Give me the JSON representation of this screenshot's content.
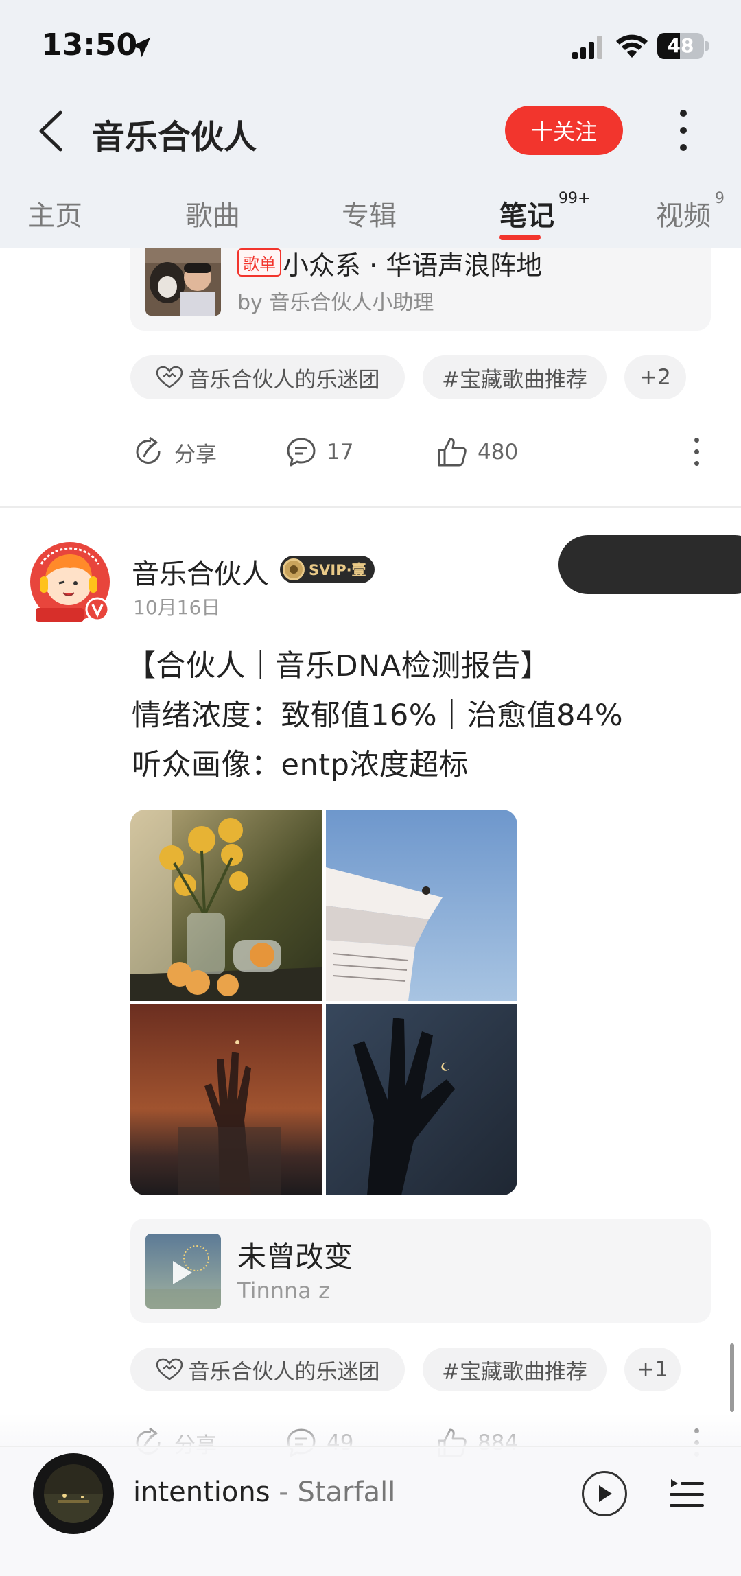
{
  "status_bar": {
    "time": "13:50",
    "battery": "48",
    "battery_level_percent": 48
  },
  "nav": {
    "title": "音乐合伙人",
    "follow_label": "十关注"
  },
  "tabs": [
    {
      "label": "主页",
      "badge": ""
    },
    {
      "label": "歌曲",
      "badge": ""
    },
    {
      "label": "专辑",
      "badge": ""
    },
    {
      "label": "笔记",
      "badge": "99+",
      "active": true
    },
    {
      "label": "视频",
      "badge": "9"
    }
  ],
  "post1": {
    "playlist": {
      "badge": "歌单",
      "title": "小众系 · 华语声浪阵地",
      "by": "by 音乐合伙人小助理"
    },
    "chips": [
      "音乐合伙人的乐迷团",
      "#宝藏歌曲推荐",
      "+2"
    ],
    "actions": {
      "share": "分享",
      "comments": "17",
      "likes": "480"
    }
  },
  "post2": {
    "author": "音乐合伙人",
    "badge": "SVIP·壹",
    "date": "10月16日",
    "lines": [
      "【合伙人｜音乐DNA检测报告】",
      "情绪浓度：致郁值16%｜治愈值84%",
      "听众画像：entp浓度超标"
    ],
    "song": {
      "title": "未曾改变",
      "artist": "Tinnna z"
    },
    "chips": [
      "音乐合伙人的乐迷团",
      "#宝藏歌曲推荐",
      "+1"
    ],
    "actions": {
      "share": "分享",
      "comments": "49",
      "likes": "884"
    }
  },
  "player": {
    "title": "intentions",
    "separator": " - ",
    "artist": "Starfall"
  },
  "colors": {
    "accent": "#f2352d",
    "background": "#ffffff",
    "header": "#eef1f5",
    "card": "#f5f5f6"
  }
}
